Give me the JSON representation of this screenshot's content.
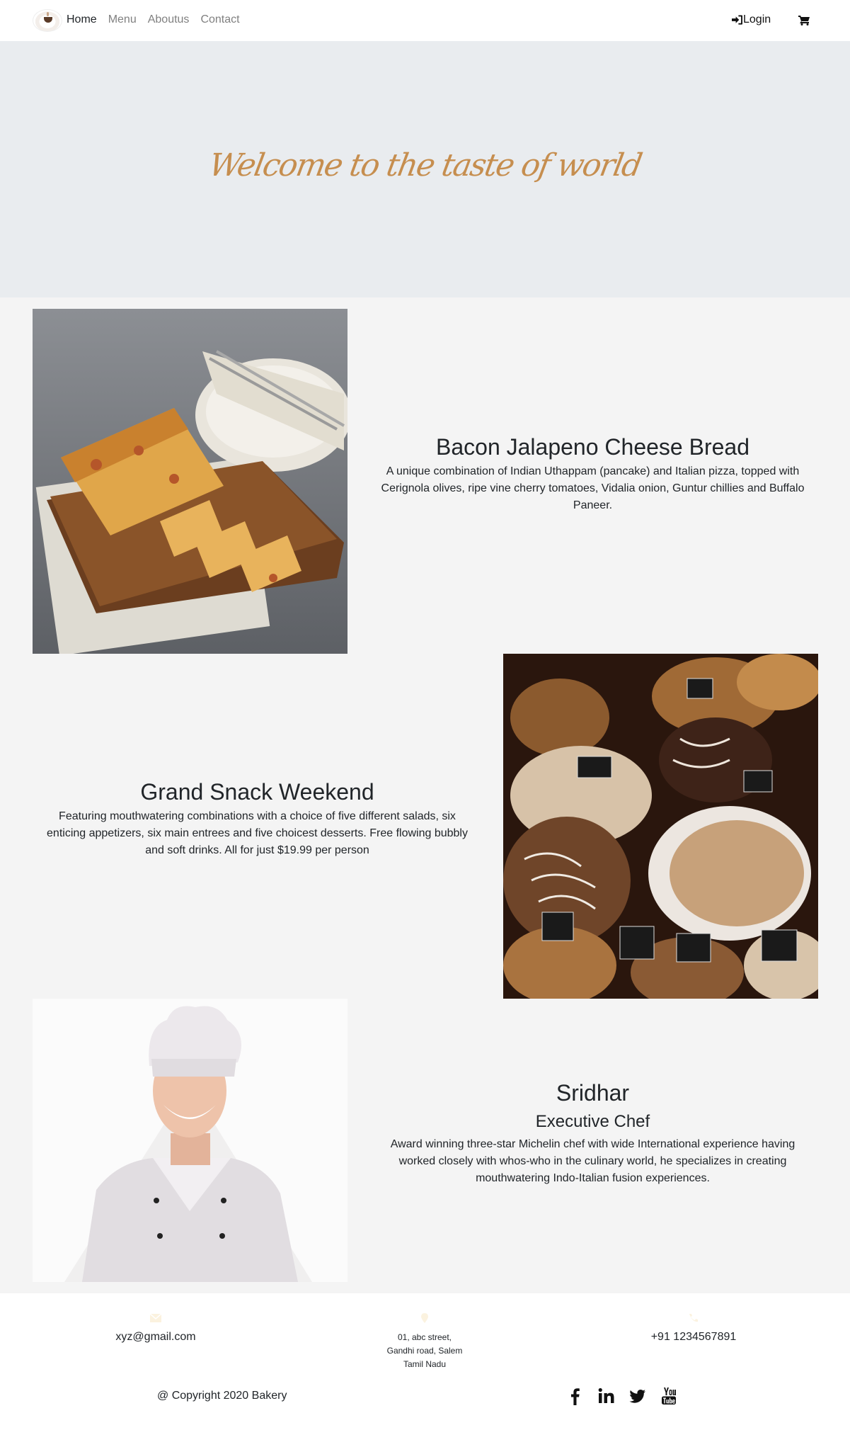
{
  "nav": {
    "links": [
      "Home",
      "Menu",
      "Aboutus",
      "Contact"
    ],
    "login_label": "Login"
  },
  "hero": {
    "title": "Welcome to the taste of world"
  },
  "features": [
    {
      "title": "Bacon Jalapeno Cheese Bread",
      "description": "A unique combination of Indian Uthappam (pancake) and Italian pizza, topped with Cerignola olives, ripe vine cherry tomatoes, Vidalia onion, Guntur chillies and Buffalo Paneer."
    },
    {
      "title": "Grand Snack Weekend",
      "description": "Featuring mouthwatering combinations with a choice of five different salads, six enticing appetizers, six main entrees and five choicest desserts. Free flowing bubbly and soft drinks. All for just $19.99 per person"
    },
    {
      "title": "Sridhar",
      "subtitle": "Executive Chef",
      "description": "Award winning three-star Michelin chef with wide International experience having worked closely with whos-who in the culinary world, he specializes in creating mouthwatering Indo-Italian fusion experiences."
    }
  ],
  "footer": {
    "email": "xyz@gmail.com",
    "address_lines": [
      "01, abc street,",
      "Gandhi road, Salem",
      "Tamil Nadu"
    ],
    "phone": "+91 1234567891",
    "copyright": "@ Copyright 2020 Bakery"
  },
  "icons": {
    "login": "sign-in-icon",
    "cart": "shopping-cart-icon",
    "email": "envelope-icon",
    "address": "map-marker-icon",
    "phone": "phone-icon",
    "socials": [
      "facebook-icon",
      "linkedin-icon",
      "twitter-icon",
      "youtube-icon"
    ]
  },
  "colors": {
    "hero_bg": "#e9ecef",
    "hero_title": "#c68e4f",
    "page_bg": "#f4f4f4",
    "nav_inactive": "#808080"
  }
}
